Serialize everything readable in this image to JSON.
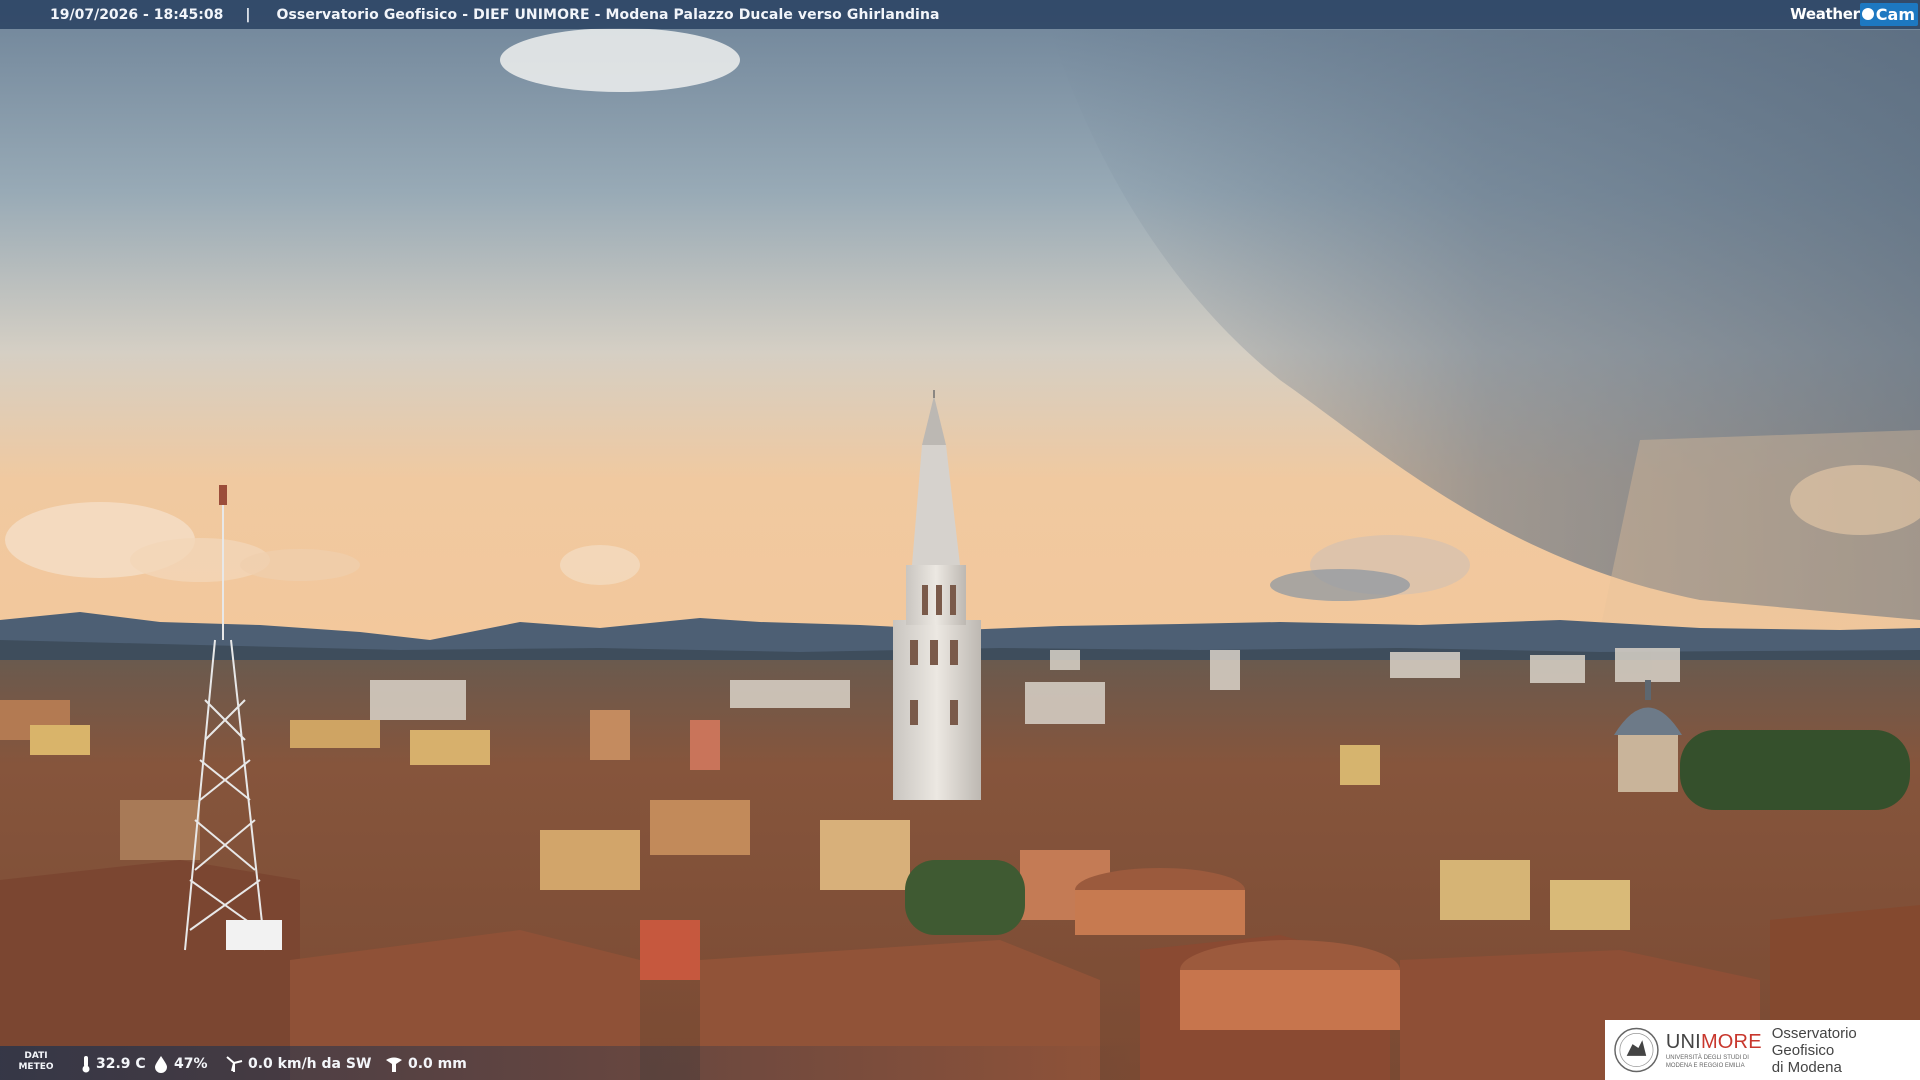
{
  "header": {
    "timestamp": "19/07/2026 - 18:45:08",
    "separator": "|",
    "caption": "Osservatorio Geofisico - DIEF UNIMORE - Modena Palazzo Ducale verso Ghirlandina",
    "brand_weather": "Weather",
    "brand_cam": "Cam"
  },
  "weather": {
    "label_line1": "DATI",
    "label_line2": "METEO",
    "temperature": "32.9 C",
    "humidity": "47%",
    "wind": "0.0 km/h da SW",
    "rain": "0.0 mm"
  },
  "logo": {
    "unimore_uni": "UNI",
    "unimore_more": "MORE",
    "unimore_sub_1": "UNIVERSITÀ DEGLI STUDI DI",
    "unimore_sub_2": "MODENA E REGGIO EMILIA",
    "observatory_line1": "Osservatorio Geofisico",
    "observatory_line2": "di Modena"
  },
  "colors": {
    "sky_top": "#6f8499",
    "sky_horizon": "#f0c9a0",
    "roof": "#9a5a3c",
    "tower": "#e4e0da",
    "unimore_red": "#c8372d",
    "bar_blue": "#263e5f"
  }
}
